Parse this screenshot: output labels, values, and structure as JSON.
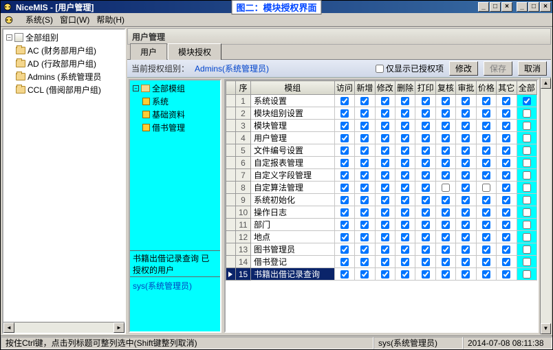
{
  "window": {
    "title": "NiceMIS - [用户管理]",
    "overlay_caption": "图二：模块授权界面",
    "min": "_",
    "max": "□",
    "close": "×"
  },
  "menu": {
    "system": "系统(S)",
    "window": "窗口(W)",
    "help": "帮助(H)"
  },
  "left_tree": {
    "root": "全部组别",
    "items": [
      "AC (财务部用户组)",
      "AD (行政部用户组)",
      "Admins (系统管理员",
      "CCL (借阅部用户组)"
    ]
  },
  "right_header": "用户管理",
  "tabs": {
    "users": "用户",
    "module_auth": "模块授权"
  },
  "toolbar": {
    "current_label": "当前授权组别：",
    "current_value": "Admins(系统管理员)",
    "only_authed": "仅显示已授权项",
    "modify": "修改",
    "save": "保存",
    "cancel": "取消"
  },
  "module_tree": {
    "root": "全部模组",
    "items": [
      "系统",
      "基础资料",
      "借书管理"
    ],
    "info": "书籍出借记录查询 已授权的用户",
    "user": "sys(系统管理员)"
  },
  "grid": {
    "headers": {
      "seq": "序",
      "name": "模组",
      "visit": "访问",
      "add": "新增",
      "edit": "修改",
      "del": "删除",
      "print": "打印",
      "reexam": "复核",
      "approve": "审批",
      "price": "价格",
      "other": "其它",
      "all": "全部"
    },
    "rows": [
      {
        "seq": 1,
        "name": "系统设置",
        "c": [
          1,
          1,
          1,
          1,
          1,
          1,
          1,
          1,
          1
        ],
        "all": 1
      },
      {
        "seq": 2,
        "name": "模块组别设置",
        "c": [
          1,
          1,
          1,
          1,
          1,
          1,
          1,
          1,
          1
        ],
        "all": 0
      },
      {
        "seq": 3,
        "name": "模块管理",
        "c": [
          1,
          1,
          1,
          1,
          1,
          1,
          1,
          1,
          1
        ],
        "all": 0
      },
      {
        "seq": 4,
        "name": "用户管理",
        "c": [
          1,
          1,
          1,
          1,
          1,
          1,
          1,
          1,
          1
        ],
        "all": 0
      },
      {
        "seq": 5,
        "name": "文件编号设置",
        "c": [
          1,
          1,
          1,
          1,
          1,
          1,
          1,
          1,
          1
        ],
        "all": 0
      },
      {
        "seq": 6,
        "name": "自定报表管理",
        "c": [
          1,
          1,
          1,
          1,
          1,
          1,
          1,
          1,
          1
        ],
        "all": 0
      },
      {
        "seq": 7,
        "name": "自定义字段管理",
        "c": [
          1,
          1,
          1,
          1,
          1,
          1,
          1,
          1,
          1
        ],
        "all": 0
      },
      {
        "seq": 8,
        "name": "自定算法管理",
        "c": [
          1,
          1,
          1,
          1,
          1,
          0,
          1,
          0,
          1
        ],
        "all": 0
      },
      {
        "seq": 9,
        "name": "系统初始化",
        "c": [
          1,
          1,
          1,
          1,
          1,
          1,
          1,
          1,
          1
        ],
        "all": 0
      },
      {
        "seq": 10,
        "name": "操作日志",
        "c": [
          1,
          1,
          1,
          1,
          1,
          1,
          1,
          1,
          1
        ],
        "all": 0
      },
      {
        "seq": 11,
        "name": "部门",
        "c": [
          1,
          1,
          1,
          1,
          1,
          1,
          1,
          1,
          1
        ],
        "all": 0
      },
      {
        "seq": 12,
        "name": "地点",
        "c": [
          1,
          1,
          1,
          1,
          1,
          1,
          1,
          1,
          1
        ],
        "all": 0
      },
      {
        "seq": 13,
        "name": "图书管理员",
        "c": [
          1,
          1,
          1,
          1,
          1,
          1,
          1,
          1,
          1
        ],
        "all": 0
      },
      {
        "seq": 14,
        "name": "借书登记",
        "c": [
          1,
          1,
          1,
          1,
          1,
          1,
          1,
          1,
          1
        ],
        "all": 0
      },
      {
        "seq": 15,
        "name": "书籍出借记录查询",
        "c": [
          1,
          1,
          1,
          1,
          1,
          1,
          1,
          1,
          1
        ],
        "all": 0,
        "selected": true
      }
    ]
  },
  "status": {
    "hint": "按住Ctrl键，点击列标题可整列选中(Shift键整列取消)",
    "user": "sys(系统管理员)",
    "time": "2014-07-08 08:11:38"
  }
}
